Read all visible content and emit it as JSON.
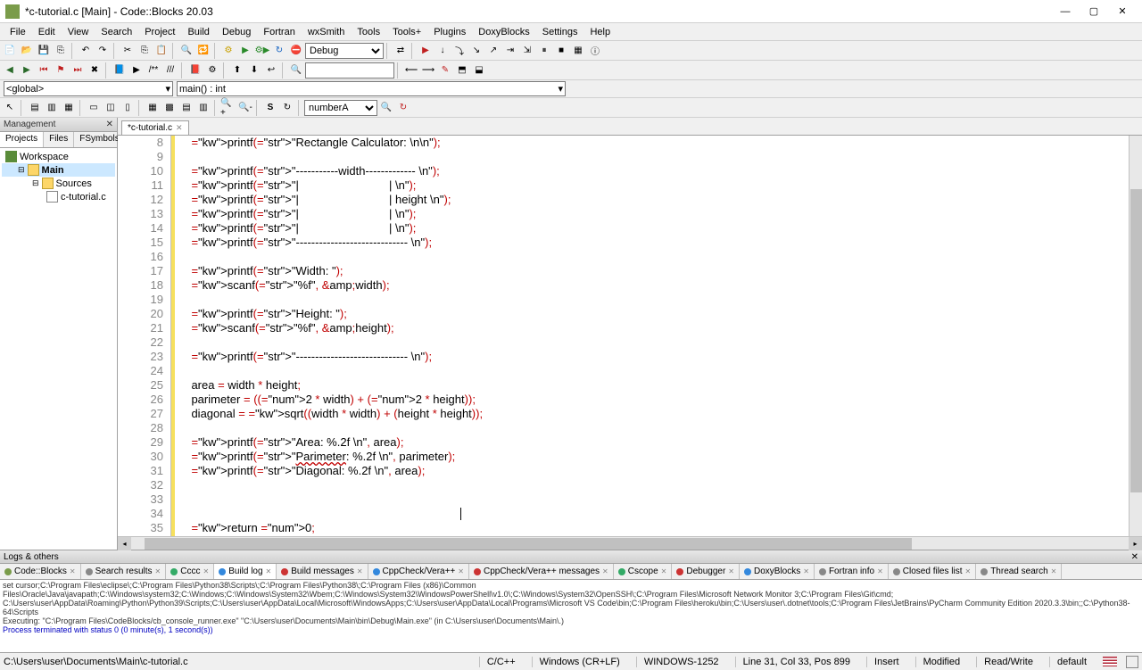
{
  "window": {
    "title": "*c-tutorial.c [Main] - Code::Blocks 20.03"
  },
  "menus": [
    "File",
    "Edit",
    "View",
    "Search",
    "Project",
    "Build",
    "Debug",
    "Fortran",
    "wxSmith",
    "Tools",
    "Tools+",
    "Plugins",
    "DoxyBlocks",
    "Settings",
    "Help"
  ],
  "build_config": "Debug",
  "scope": {
    "global": "<global>",
    "func": "main() : int"
  },
  "search_combo": "numberA",
  "management": {
    "title": "Management",
    "tabs": [
      "Projects",
      "Files",
      "FSymbols"
    ],
    "active_tab": 0,
    "tree": {
      "workspace": "Workspace",
      "project": "Main",
      "sources": "Sources",
      "file": "c-tutorial.c"
    }
  },
  "editor_tab": "*c-tutorial.c",
  "code": {
    "first_line": 8,
    "lines": [
      {
        "n": 8,
        "t": "    printf(\"Rectangle Calculator: \\n\\n\");"
      },
      {
        "n": 9,
        "t": ""
      },
      {
        "n": 10,
        "t": "    printf(\"-----------width------------- \\n\");"
      },
      {
        "n": 11,
        "t": "    printf(\"|                            | \\n\");"
      },
      {
        "n": 12,
        "t": "    printf(\"|                            | height \\n\");"
      },
      {
        "n": 13,
        "t": "    printf(\"|                            | \\n\");"
      },
      {
        "n": 14,
        "t": "    printf(\"|                            | \\n\");"
      },
      {
        "n": 15,
        "t": "    printf(\"----------------------------- \\n\");"
      },
      {
        "n": 16,
        "t": ""
      },
      {
        "n": 17,
        "t": "    printf(\"Width: \");"
      },
      {
        "n": 18,
        "t": "    scanf(\"%f\", &width);"
      },
      {
        "n": 19,
        "t": ""
      },
      {
        "n": 20,
        "t": "    printf(\"Height: \");"
      },
      {
        "n": 21,
        "t": "    scanf(\"%f\", &height);"
      },
      {
        "n": 22,
        "t": ""
      },
      {
        "n": 23,
        "t": "    printf(\"----------------------------- \\n\");"
      },
      {
        "n": 24,
        "t": ""
      },
      {
        "n": 25,
        "t": "    area = width * height;"
      },
      {
        "n": 26,
        "t": "    parimeter = ((2 * width) + (2 * height));"
      },
      {
        "n": 27,
        "t": "    diagonal = sqrt((width * width) + (height * height));"
      },
      {
        "n": 28,
        "t": ""
      },
      {
        "n": 29,
        "t": "    printf(\"Area: %.2f \\n\", area);"
      },
      {
        "n": 30,
        "t": "    printf(\"Parimeter: %.2f \\n\", parimeter);"
      },
      {
        "n": 31,
        "t": "    printf(\"Diagonal: %.2f \\n\", area);"
      },
      {
        "n": 32,
        "t": ""
      },
      {
        "n": 33,
        "t": ""
      },
      {
        "n": 34,
        "t": ""
      },
      {
        "n": 35,
        "t": "    return 0;"
      }
    ]
  },
  "logs": {
    "title": "Logs & others",
    "tabs": [
      "Code::Blocks",
      "Search results",
      "Cccc",
      "Build log",
      "Build messages",
      "CppCheck/Vera++",
      "CppCheck/Vera++ messages",
      "Cscope",
      "Debugger",
      "DoxyBlocks",
      "Fortran info",
      "Closed files list",
      "Thread search"
    ],
    "active_tab": 3,
    "content_paths": "set cursor;C:\\Program Files\\eclipse\\;C:\\Program Files\\Python38\\Scripts\\;C:\\Program Files\\Python38\\;C:\\Program Files (x86)\\Common Files\\Oracle\\Java\\javapath;C:\\Windows\\system32;C:\\Windows;C:\\Windows\\System32\\Wbem;C:\\Windows\\System32\\WindowsPowerShell\\v1.0\\;C:\\Windows\\System32\\OpenSSH\\;C:\\Program Files\\Microsoft Network Monitor 3;C:\\Program Files\\Git\\cmd;",
    "content_users": "C:\\Users\\user\\AppData\\Roaming\\Python\\Python39\\Scripts;C:\\Users\\user\\AppData\\Local\\Microsoft\\WindowsApps;C:\\Users\\user\\AppData\\Local\\Programs\\Microsoft VS Code\\bin;C:\\Program Files\\heroku\\bin;C:\\Users\\user\\.dotnet\\tools;C:\\Program Files\\JetBrains\\PyCharm Community Edition 2020.3.3\\bin;;C:\\Python38-64\\Scripts",
    "content_exec": "Executing: \"C:\\Program Files\\CodeBlocks/cb_console_runner.exe\" \"C:\\Users\\user\\Documents\\Main\\bin\\Debug\\Main.exe\"  (in C:\\Users\\user\\Documents\\Main\\.)",
    "content_term": "Process terminated with status 0 (0 minute(s), 1 second(s))"
  },
  "status": {
    "path": "C:\\Users\\user\\Documents\\Main\\c-tutorial.c",
    "lang": "C/C++",
    "eol": "Windows (CR+LF)",
    "enc": "WINDOWS-1252",
    "pos": "Line 31, Col 33, Pos 899",
    "ins": "Insert",
    "mod": "Modified",
    "rw": "Read/Write",
    "prof": "default"
  }
}
